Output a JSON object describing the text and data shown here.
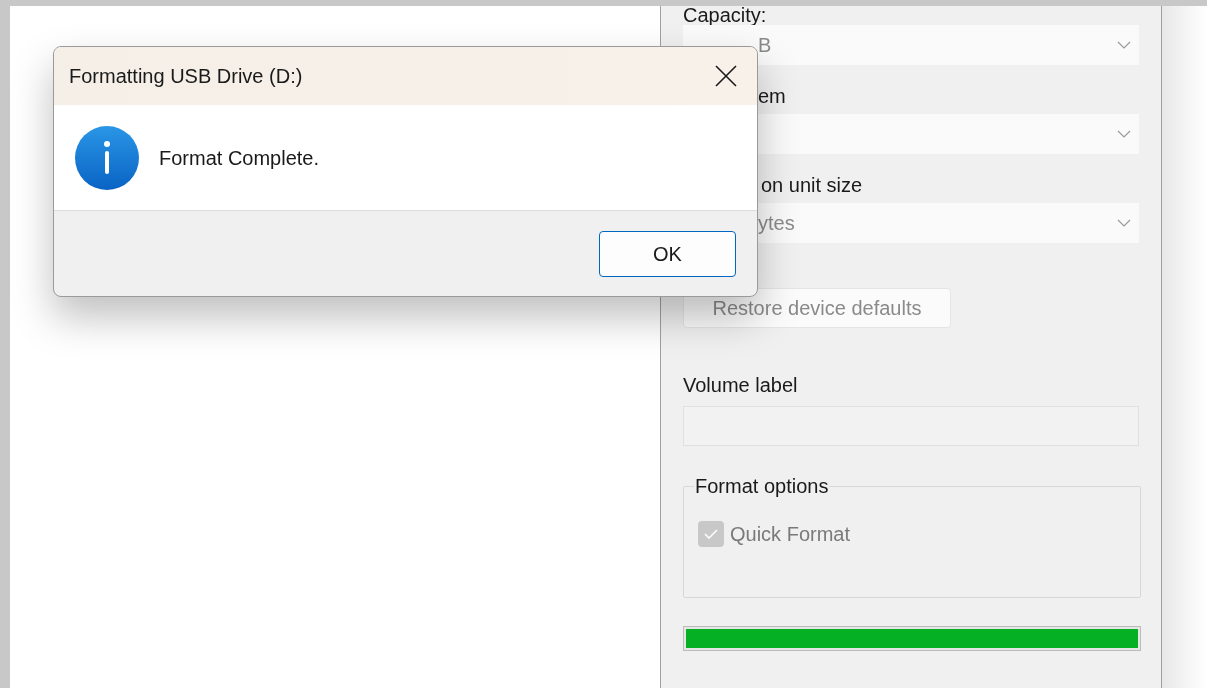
{
  "format_window": {
    "capacity_label": "Capacity:",
    "capacity_value": "B",
    "file_system_label": "em",
    "allocation_label": "on unit size",
    "allocation_value": "ytes",
    "restore_button": {
      "label": "Restore device defaults",
      "disabled": true
    },
    "volume_label": {
      "label": "Volume label"
    },
    "format_options": {
      "title": "Format options",
      "quick_format": {
        "label": "Quick Format",
        "checked": true,
        "disabled": true
      }
    },
    "progress": {
      "level": 1
    }
  },
  "dialog": {
    "title": "Formatting USB Drive (D:)",
    "message": "Format Complete.",
    "buttons": [
      {
        "label": "OK",
        "default": true
      }
    ]
  }
}
